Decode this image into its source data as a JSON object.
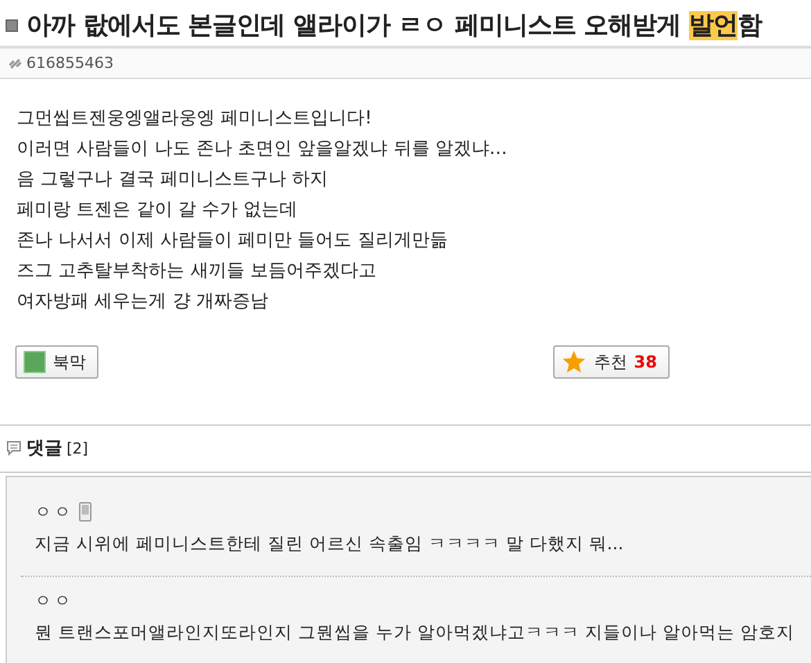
{
  "title": [
    {
      "text": "아까 랎에서도 본글인데 앨라이가 ㄹㅇ 페미니스트 오해받게 ",
      "highlighted": false
    },
    {
      "text": "발언",
      "highlighted": true
    },
    {
      "text": "함",
      "highlighted": false
    }
  ],
  "post_id": "616855463",
  "body": [
    "그먼씹트젠웅엥앨라웅엥 페미니스트입니다!",
    "이러면 사람들이 나도 존나 초면인 앞을알겠냐 뒤를 알겠냐…",
    "음 그렇구나 결국 페미니스트구나 하지",
    "페미랑 트젠은 같이 갈 수가 없는데",
    "존나 나서서 이제 사람들이 페미만 들어도 질리게만듦",
    "즈그 고추탈부착하는 새끼들 보듬어주겠다고",
    "여자방패 세우는게 걍 개짜증남"
  ],
  "bookmark_button": {
    "label": "북막"
  },
  "recommend_button": {
    "label": "추천",
    "count": "38"
  },
  "comments_header": {
    "label": "댓글",
    "count": "[2]"
  },
  "comments": [
    {
      "author": "ㅇㅇ",
      "mobile": true,
      "text": "지금 시위에 페미니스트한테 질린 어르신 속출임 ㅋㅋㅋㅋ 말 다했지 뭐..."
    },
    {
      "author": "ㅇㅇ",
      "mobile": false,
      "text": "뭔 트랜스포머앨라인지또라인지 그뭔씹을 누가 알아먹겠냐고ㅋㅋㅋ 지들이나 알아먹는 암호지"
    }
  ]
}
